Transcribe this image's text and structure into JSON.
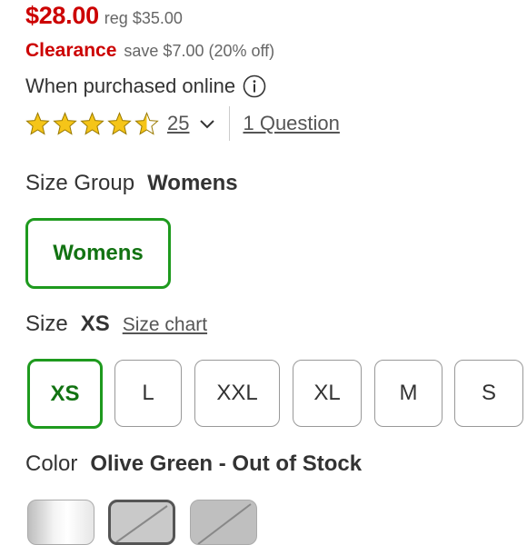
{
  "price": {
    "current": "$28.00",
    "regular": "reg $35.00",
    "clearance_label": "Clearance",
    "savings": "save $7.00 (20% off)",
    "online_note": "When purchased online"
  },
  "rating": {
    "stars": 4.5,
    "max_stars": 5,
    "review_count": "25",
    "questions_link": "1 Question"
  },
  "size_group": {
    "label": "Size Group",
    "selected": "Womens",
    "options": [
      "Womens"
    ]
  },
  "size": {
    "label": "Size",
    "selected": "XS",
    "chart_link": "Size chart",
    "options": [
      "XS",
      "L",
      "XXL",
      "XL",
      "M",
      "S"
    ]
  },
  "color": {
    "label": "Color",
    "selected": "Olive Green - Out of Stock"
  },
  "icons": {
    "info": "info-icon",
    "star": "star-icon",
    "chevron": "chevron-down-icon"
  },
  "colors": {
    "sale_red": "#cc0000",
    "selected_green": "#1e9a1e",
    "text": "#333333",
    "muted": "#666666"
  }
}
